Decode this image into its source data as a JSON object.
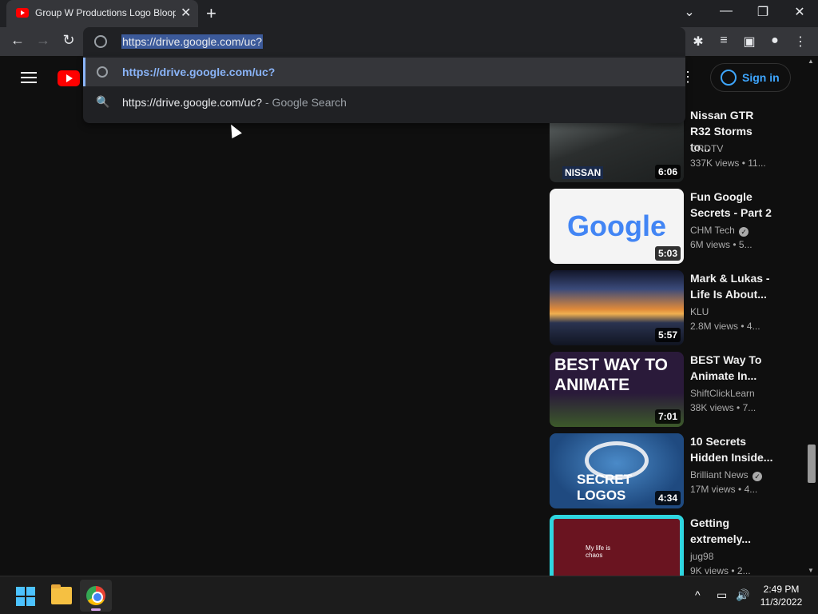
{
  "browser": {
    "tab_title": "Group W Productions Logo Bloop",
    "tab_close": "✕",
    "new_tab": "+",
    "url": "https://drive.google.com/uc?",
    "window_controls": {
      "minimize": "—",
      "maximize": "❐",
      "close": "✕",
      "tab_search": "⌄"
    },
    "nav": {
      "back": "←",
      "forward": "→",
      "reload": "↻"
    },
    "toolbar_icons": {
      "extensions": "✱",
      "media": "≡",
      "sidepanel": "▣",
      "profile": "●",
      "menu": "⋮"
    }
  },
  "omnibox_dropdown": {
    "suggestions": [
      {
        "text": "https://drive.google.com/uc?",
        "type": "url"
      },
      {
        "text": "https://drive.google.com/uc?",
        "suffix": " - Google Search",
        "type": "search",
        "icon": "🔍"
      }
    ]
  },
  "youtube": {
    "header": {
      "signin_label": "Sign in",
      "more_icon": "⋮"
    },
    "videos": [
      {
        "title": "Nissan GTR R32 Storms to...",
        "channel": "CRDTV",
        "verified": false,
        "views": "337K views",
        "age": "11...",
        "duration": "6:06",
        "thumb_text": "NISSAN"
      },
      {
        "title": "Fun Google Secrets - Part 2",
        "channel": "CHM Tech",
        "verified": true,
        "views": "6M views",
        "age": "5...",
        "duration": "5:03",
        "thumb_text": "Google"
      },
      {
        "title": "Mark & Lukas - Life Is About...",
        "channel": "KLU",
        "verified": false,
        "views": "2.8M views",
        "age": "4...",
        "duration": "5:57",
        "thumb_text": ""
      },
      {
        "title": "BEST Way To Animate In...",
        "channel": "ShiftClickLearn",
        "verified": false,
        "views": "38K views",
        "age": "7...",
        "duration": "7:01",
        "thumb_text": "BEST WAY TO ANIMATE"
      },
      {
        "title": "10 Secrets Hidden Inside...",
        "channel": "Brilliant News",
        "verified": true,
        "views": "17M views",
        "age": "4...",
        "duration": "4:34",
        "thumb_text": "SECRET LOGOS"
      },
      {
        "title": "Getting extremely...",
        "channel": "jug98",
        "verified": false,
        "views": "9K views",
        "age": "2...",
        "duration": "",
        "thumb_text": "My life is chaos"
      }
    ]
  },
  "taskbar": {
    "tray": {
      "chevron": "^",
      "network": "▭",
      "volume": "🔊"
    },
    "time": "2:49 PM",
    "date": "11/3/2022"
  },
  "colors": {
    "accent_link": "#8ab4f8",
    "signin_blue": "#3ea6ff",
    "youtube_red": "#ff0000"
  }
}
